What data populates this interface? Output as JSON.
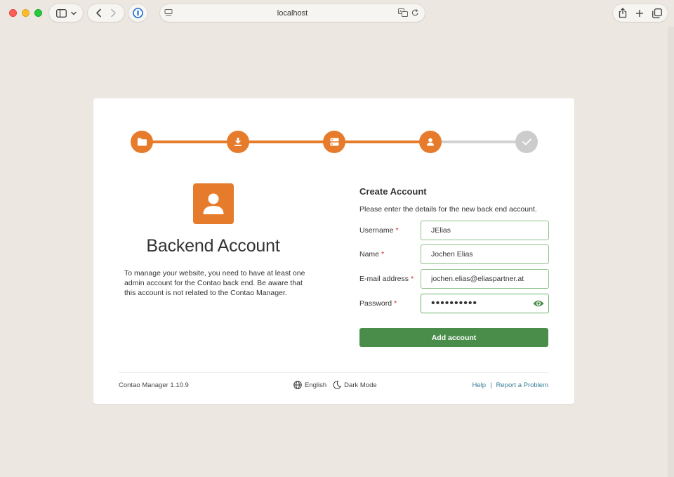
{
  "browser": {
    "url": "localhost"
  },
  "steps": [
    {
      "icon": "folder-icon",
      "status": "done"
    },
    {
      "icon": "download-icon",
      "status": "done"
    },
    {
      "icon": "server-icon",
      "status": "done"
    },
    {
      "icon": "user-icon",
      "status": "current"
    },
    {
      "icon": "check-icon",
      "status": "todo"
    }
  ],
  "left": {
    "title": "Backend Account",
    "description": "To manage your website, you need to have at least one admin account for the Contao back end. Be aware that this account is not related to the Contao Manager."
  },
  "form": {
    "title": "Create Account",
    "description": "Please enter the details for the new back end account.",
    "username": {
      "label": "Username",
      "value": "JElias"
    },
    "name": {
      "label": "Name",
      "value": "Jochen Elias"
    },
    "email": {
      "label": "E-mail address",
      "value": "jochen.elias@eliaspartner.at"
    },
    "password": {
      "label": "Password",
      "value": "••••••••••"
    },
    "required_marker": "*",
    "submit_label": "Add account"
  },
  "footer": {
    "version": "Contao Manager 1.10.9",
    "language": "English",
    "dark_mode": "Dark Mode",
    "help": "Help",
    "separator": "|",
    "report": "Report a Problem"
  },
  "colors": {
    "accent": "#e67c2b",
    "success": "#4a8d4b",
    "link": "#3a7f94"
  }
}
